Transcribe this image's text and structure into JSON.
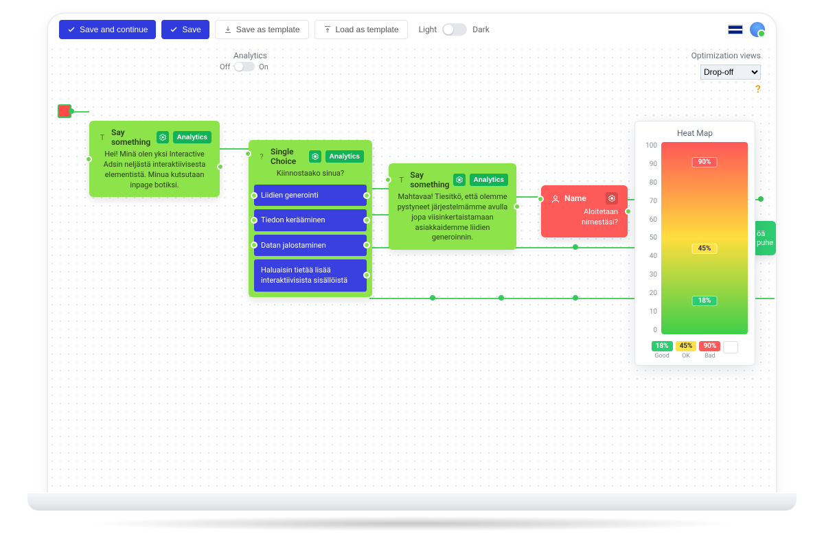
{
  "toolbar": {
    "save_continue": "Save and continue",
    "save": "Save",
    "save_as_template": "Save as template",
    "load_as_template": "Load as template",
    "theme_light": "Light",
    "theme_dark": "Dark"
  },
  "sections": {
    "analytics_label": "Analytics",
    "analytics_off": "Off",
    "analytics_on": "On",
    "optimization_views": "Optimization views",
    "opt_select_value": "Drop-off"
  },
  "nodes": {
    "say1": {
      "title": "Say something",
      "analytics_btn": "Analytics",
      "body": "Hei! Minä olen yksi Interactive Adsin neljästä interaktiivisesta elementistä. Minua kutsutaan inpage botiksi."
    },
    "choice": {
      "title": "Single Choice",
      "analytics_btn": "Analytics",
      "prompt": "Kiinnostaako sinua?",
      "options": [
        "Liidien generointi",
        "Tiedon kerääminen",
        "Datan jalostaminen",
        "Haluaisin tietää lisää interaktiivisista sisällöistä"
      ]
    },
    "say2": {
      "title": "Say something",
      "analytics_btn": "Analytics",
      "body": "Mahtavaa! Tiesitkö, että olemme pystyneet järjestelmämme avulla jopa viisinkertaistamaan asiakkaidemme liidien generoinnin."
    },
    "name": {
      "title": "Name",
      "body": "Aloitetaan nimestäsi?"
    },
    "peek": {
      "body": "öä puhe"
    }
  },
  "heat": {
    "title": "Heat Map",
    "ticks": [
      "100",
      "90",
      "80",
      "70",
      "60",
      "50",
      "40",
      "30",
      "20",
      "10",
      "0"
    ],
    "pill_top": "90%",
    "pill_mid": "45%",
    "pill_bot": "18%",
    "legend_good_val": "18%",
    "legend_good_lbl": "Good",
    "legend_ok_val": "45%",
    "legend_ok_lbl": "OK",
    "legend_bad_val": "90%",
    "legend_bad_lbl": "Bad"
  },
  "chart_data": {
    "type": "bar",
    "title": "Heat Map",
    "orientation": "vertical-gradient",
    "ylim": [
      0,
      100
    ],
    "ticks": [
      0,
      10,
      20,
      30,
      40,
      50,
      60,
      70,
      80,
      90,
      100
    ],
    "markers": [
      {
        "label": "90%",
        "value": 90,
        "category": "Bad",
        "color": "#ff5a5a"
      },
      {
        "label": "45%",
        "value": 45,
        "category": "OK",
        "color": "#ffe24a"
      },
      {
        "label": "18%",
        "value": 18,
        "category": "Good",
        "color": "#2ecc71"
      }
    ],
    "legend": [
      {
        "name": "Good",
        "value": 18,
        "color": "#2ecc71"
      },
      {
        "name": "OK",
        "value": 45,
        "color": "#ffe24a"
      },
      {
        "name": "Bad",
        "value": 90,
        "color": "#ff5a5a"
      }
    ]
  }
}
